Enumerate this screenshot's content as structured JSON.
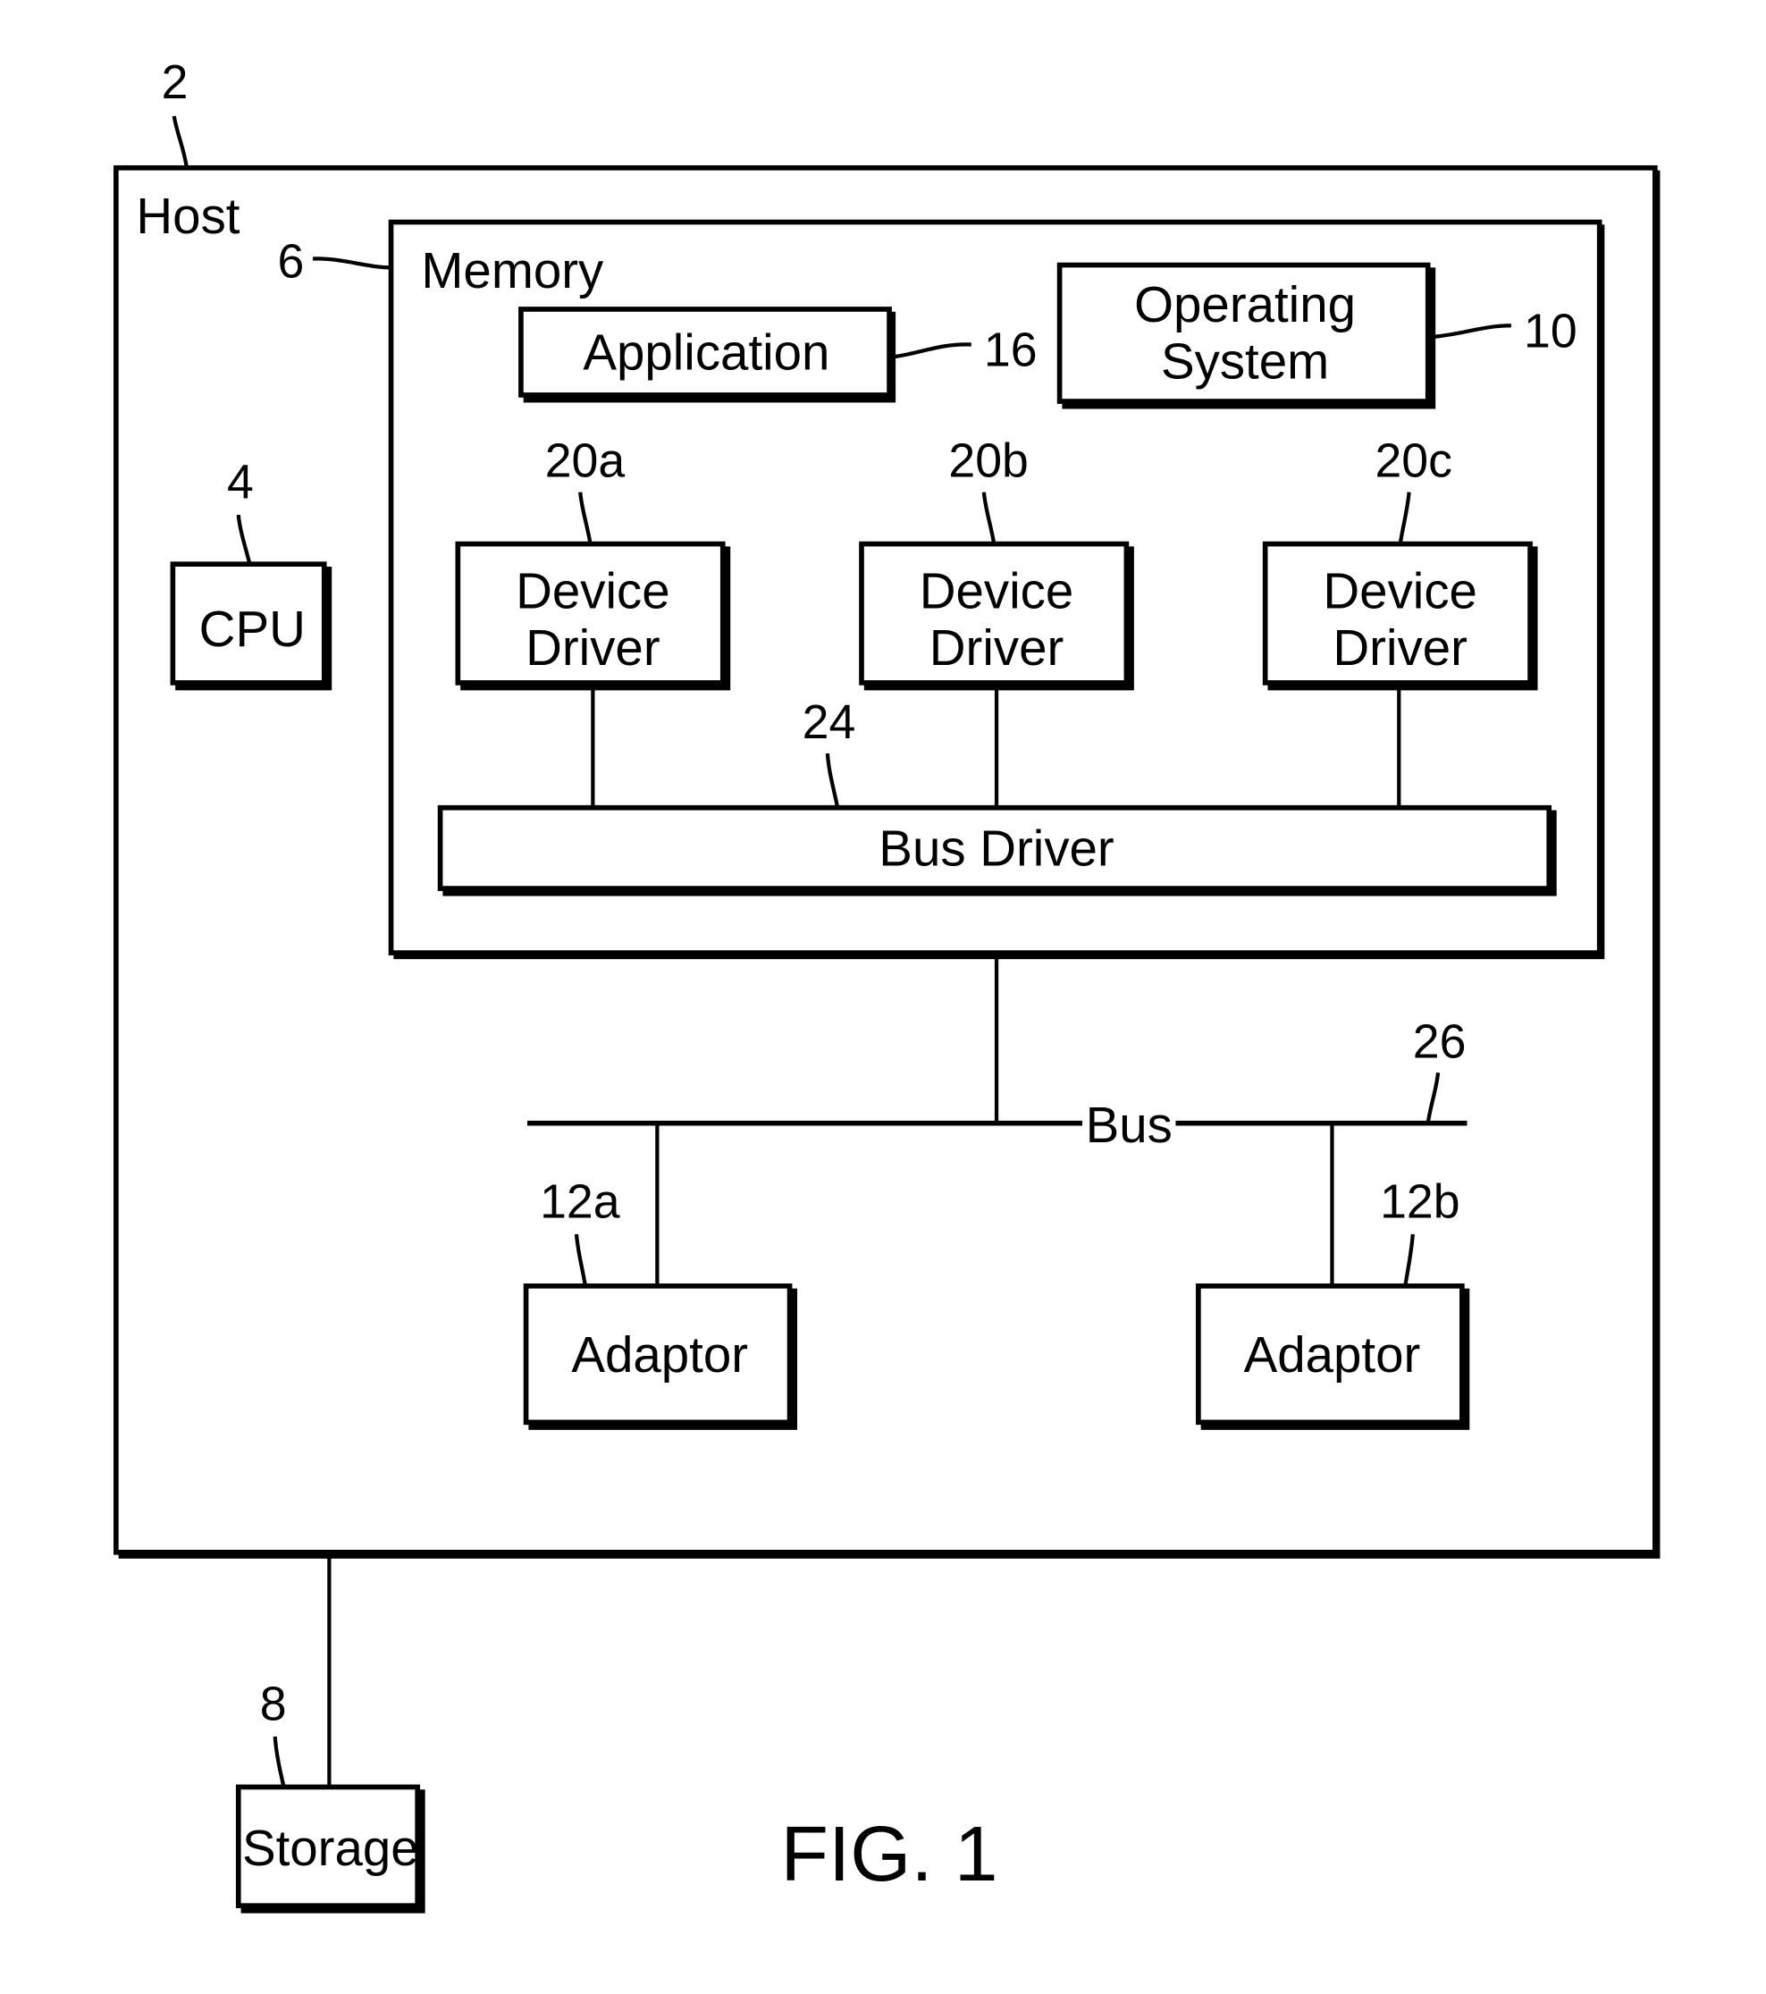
{
  "figure": {
    "caption": "FIG. 1",
    "host": {
      "label": "Host",
      "ref": "2"
    },
    "cpu": {
      "label": "CPU",
      "ref": "4"
    },
    "memory": {
      "label": "Memory",
      "ref": "6"
    },
    "storage": {
      "label": "Storage",
      "ref": "8"
    },
    "operating_system": {
      "line1": "Operating",
      "line2": "System",
      "ref": "10"
    },
    "application": {
      "label": "Application",
      "ref": "16"
    },
    "device_drivers": [
      {
        "line1": "Device",
        "line2": "Driver",
        "ref": "20a"
      },
      {
        "line1": "Device",
        "line2": "Driver",
        "ref": "20b"
      },
      {
        "line1": "Device",
        "line2": "Driver",
        "ref": "20c"
      }
    ],
    "bus_driver": {
      "label": "Bus Driver",
      "ref": "24"
    },
    "bus": {
      "label": "Bus",
      "ref": "26"
    },
    "adaptors": [
      {
        "label": "Adaptor",
        "ref": "12a"
      },
      {
        "label": "Adaptor",
        "ref": "12b"
      }
    ]
  }
}
